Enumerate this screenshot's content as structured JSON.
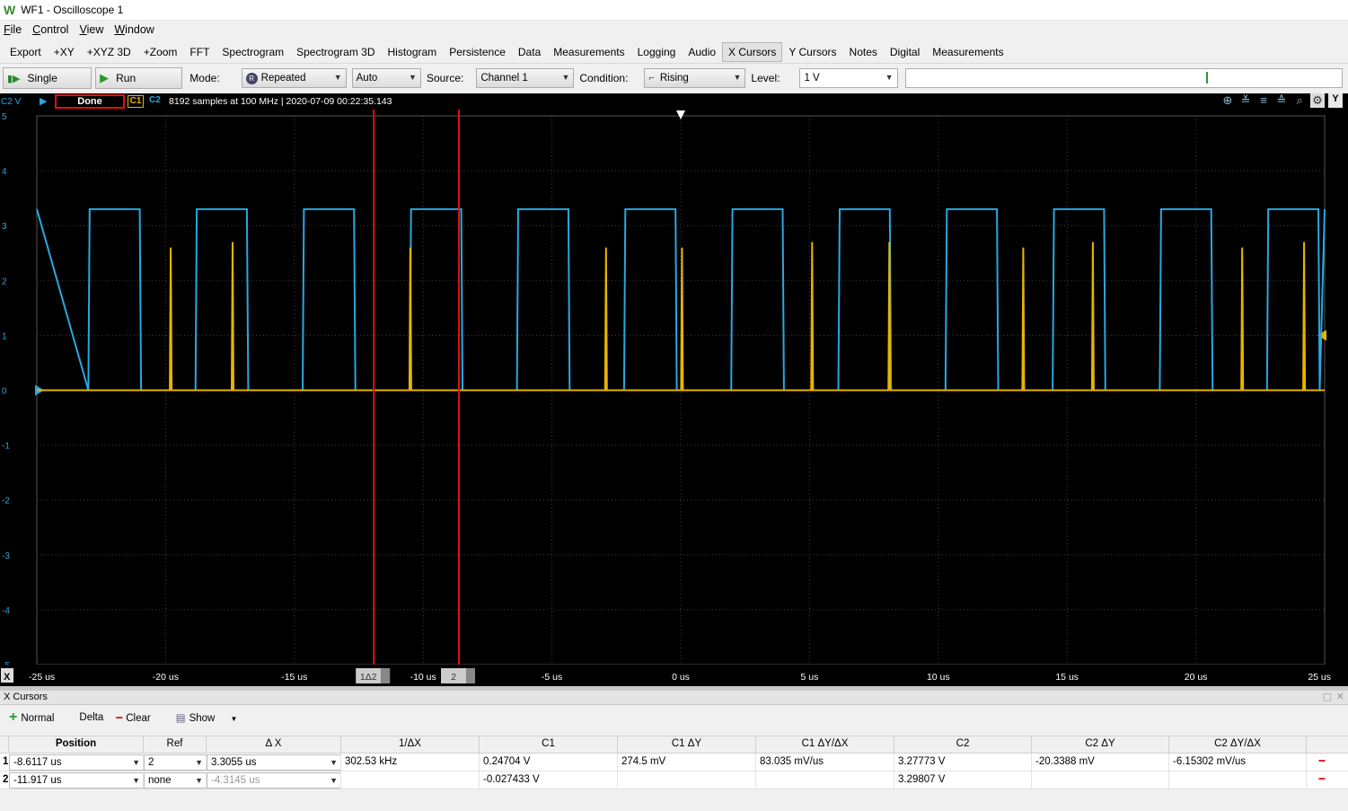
{
  "window": {
    "title": "WF1 - Oscilloscope 1",
    "logo": "W"
  },
  "menu": [
    "File",
    "Control",
    "View",
    "Window"
  ],
  "toolbar": [
    "Export",
    "+XY",
    "+XYZ 3D",
    "+Zoom",
    "FFT",
    "Spectrogram",
    "Spectrogram 3D",
    "Histogram",
    "Persistence",
    "Data",
    "Measurements",
    "Logging",
    "Audio",
    "X Cursors",
    "Y Cursors",
    "Notes",
    "Digital",
    "Measurements"
  ],
  "toolbar_active": "X Cursors",
  "acq": {
    "single": "Single",
    "run": "Run",
    "mode_label": "Mode:",
    "mode": "Repeated",
    "auto": "Auto",
    "source_label": "Source:",
    "source": "Channel 1",
    "condition_label": "Condition:",
    "condition": "Rising",
    "level_label": "Level:",
    "level": "1 V"
  },
  "scope": {
    "c2v": "C2 V",
    "status": "Done",
    "c1": "C1",
    "c2": "C2",
    "samples": "8192 samples at 100 MHz | 2020-07-09 00:22:35.143",
    "y_ticks": [
      "5",
      "4",
      "3",
      "2",
      "1",
      "0",
      "-1",
      "-2",
      "-3",
      "-4",
      "-5"
    ],
    "x_ticks": [
      "-25 us",
      "-20 us",
      "-15 us",
      "-10 us",
      "-5 us",
      "0 us",
      "5 us",
      "10 us",
      "15 us",
      "20 us",
      "25 us"
    ],
    "x_label": "X",
    "cursor1_tag": "2",
    "cursor2_tag": "1Δ2",
    "colors": {
      "c1": "#e8b400",
      "c2": "#28a8e0",
      "cursor": "#e01010",
      "grid": "#404040"
    }
  },
  "chart_data": {
    "type": "line",
    "xlabel": "",
    "ylabel": "C2 V",
    "xlim": [
      -25,
      25
    ],
    "ylim": [
      -5,
      5
    ],
    "x_unit": "us",
    "series": [
      {
        "name": "C2",
        "period_us": 4.16,
        "high_v": 3.3,
        "low_v": 0,
        "duty": 0.48,
        "first_rise_us": -23.0
      },
      {
        "name": "C1",
        "spike_times_us": [
          -19.8,
          -17.4,
          -10.5,
          -2.9,
          0.05,
          5.1,
          8.1,
          13.3,
          16.0,
          21.8,
          24.2
        ],
        "spike_heights_v": [
          2.6,
          2.7,
          2.6,
          2.6,
          2.6,
          2.7,
          2.7,
          2.6,
          2.7,
          2.6,
          2.7
        ],
        "baseline_v": 0
      }
    ],
    "cursors_us": [
      -11.917,
      -8.6117
    ]
  },
  "xcursors": {
    "title": "X Cursors",
    "tools": [
      "Normal",
      "Delta",
      "Clear",
      "Show"
    ],
    "columns": [
      "Position",
      "Ref",
      "Δ X",
      "1/ΔX",
      "C1",
      "C1 ΔY",
      "C1 ΔY/ΔX",
      "C2",
      "C2 ΔY",
      "C2 ΔY/ΔX"
    ],
    "rows": [
      {
        "idx": "1",
        "position": "-8.6117 us",
        "ref": "2",
        "dx": "3.3055 us",
        "inv_dx": "302.53 kHz",
        "c1": "0.24704 V",
        "c1_dy": "274.5 mV",
        "c1_dydx": "83.035 mV/us",
        "c2": "3.27773 V",
        "c2_dy": "-20.3388 mV",
        "c2_dydx": "-6.15302 mV/us"
      },
      {
        "idx": "2",
        "position": "-11.917 us",
        "ref": "none",
        "dx": "-4.3145 us",
        "inv_dx": "",
        "c1": "-0.027433 V",
        "c1_dy": "",
        "c1_dydx": "",
        "c2": "3.29807 V",
        "c2_dy": "",
        "c2_dydx": ""
      }
    ]
  }
}
